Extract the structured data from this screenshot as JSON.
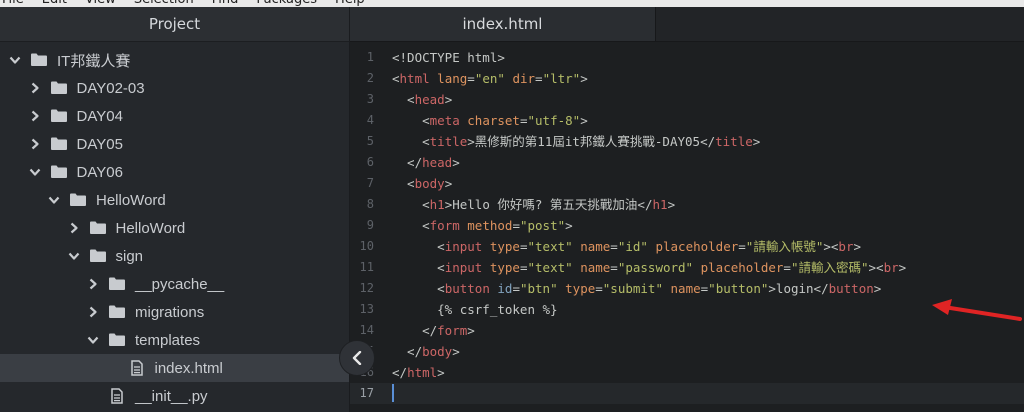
{
  "menu": [
    "File",
    "Edit",
    "View",
    "Selection",
    "Find",
    "Packages",
    "Help"
  ],
  "sidebar": {
    "title": "Project",
    "items": [
      {
        "label": "IT邦鐵人賽",
        "type": "folder",
        "expanded": true
      },
      {
        "label": "DAY02-03",
        "type": "folder",
        "expanded": false
      },
      {
        "label": "DAY04",
        "type": "folder",
        "expanded": false
      },
      {
        "label": "DAY05",
        "type": "folder",
        "expanded": false
      },
      {
        "label": "DAY06",
        "type": "folder",
        "expanded": true
      },
      {
        "label": "HelloWord",
        "type": "folder",
        "expanded": true
      },
      {
        "label": "HelloWord",
        "type": "folder",
        "expanded": false
      },
      {
        "label": "sign",
        "type": "folder",
        "expanded": true
      },
      {
        "label": "__pycache__",
        "type": "folder",
        "expanded": false
      },
      {
        "label": "migrations",
        "type": "folder",
        "expanded": false
      },
      {
        "label": "templates",
        "type": "folder",
        "expanded": true
      },
      {
        "label": "index.html",
        "type": "file",
        "selected": true
      },
      {
        "label": "__init__.py",
        "type": "file"
      }
    ]
  },
  "editor": {
    "tab": "index.html",
    "lines": [
      {
        "n": "1",
        "tokens": [
          [
            "t-text",
            "<!DOCTYPE html>"
          ]
        ]
      },
      {
        "n": "2",
        "tokens": [
          [
            "t-text",
            "<"
          ],
          [
            "t-tag",
            "html"
          ],
          [
            "t-text",
            " "
          ],
          [
            "t-attr",
            "lang"
          ],
          [
            "t-text",
            "="
          ],
          [
            "t-str",
            "\"en\""
          ],
          [
            "t-text",
            " "
          ],
          [
            "t-attr",
            "dir"
          ],
          [
            "t-text",
            "="
          ],
          [
            "t-str",
            "\"ltr\""
          ],
          [
            "t-text",
            ">"
          ]
        ]
      },
      {
        "n": "3",
        "tokens": [
          [
            "t-text",
            "  <"
          ],
          [
            "t-tag",
            "head"
          ],
          [
            "t-text",
            ">"
          ]
        ]
      },
      {
        "n": "4",
        "tokens": [
          [
            "t-text",
            "    <"
          ],
          [
            "t-tag",
            "meta"
          ],
          [
            "t-text",
            " "
          ],
          [
            "t-attr",
            "charset"
          ],
          [
            "t-text",
            "="
          ],
          [
            "t-str",
            "\"utf-8\""
          ],
          [
            "t-text",
            ">"
          ]
        ]
      },
      {
        "n": "5",
        "tokens": [
          [
            "t-text",
            "    <"
          ],
          [
            "t-tag",
            "title"
          ],
          [
            "t-text",
            ">黑修斯的第11屆it邦鐵人賽挑戰-DAY05</"
          ],
          [
            "t-tag",
            "title"
          ],
          [
            "t-text",
            ">"
          ]
        ]
      },
      {
        "n": "6",
        "tokens": [
          [
            "t-text",
            "  </"
          ],
          [
            "t-tag",
            "head"
          ],
          [
            "t-text",
            ">"
          ]
        ]
      },
      {
        "n": "7",
        "tokens": [
          [
            "t-text",
            "  <"
          ],
          [
            "t-tag",
            "body"
          ],
          [
            "t-text",
            ">"
          ]
        ]
      },
      {
        "n": "8",
        "tokens": [
          [
            "t-text",
            "    <"
          ],
          [
            "t-tag",
            "h1"
          ],
          [
            "t-text",
            ">Hello 你好嗎? 第五天挑戰加油</"
          ],
          [
            "t-tag",
            "h1"
          ],
          [
            "t-text",
            ">"
          ]
        ]
      },
      {
        "n": "9",
        "tokens": [
          [
            "t-text",
            "    <"
          ],
          [
            "t-tag",
            "form"
          ],
          [
            "t-text",
            " "
          ],
          [
            "t-attr",
            "method"
          ],
          [
            "t-text",
            "="
          ],
          [
            "t-str",
            "\"post\""
          ],
          [
            "t-text",
            ">"
          ]
        ]
      },
      {
        "n": "10",
        "tokens": [
          [
            "t-text",
            "      <"
          ],
          [
            "t-tag",
            "input"
          ],
          [
            "t-text",
            " "
          ],
          [
            "t-attr",
            "type"
          ],
          [
            "t-text",
            "="
          ],
          [
            "t-str",
            "\"text\""
          ],
          [
            "t-text",
            " "
          ],
          [
            "t-attr",
            "name"
          ],
          [
            "t-text",
            "="
          ],
          [
            "t-str",
            "\"id\""
          ],
          [
            "t-text",
            " "
          ],
          [
            "t-attr",
            "placeholder"
          ],
          [
            "t-text",
            "="
          ],
          [
            "t-str",
            "\"請輸入帳號\""
          ],
          [
            "t-text",
            "><"
          ],
          [
            "t-tag",
            "br"
          ],
          [
            "t-text",
            ">"
          ]
        ]
      },
      {
        "n": "11",
        "tokens": [
          [
            "t-text",
            "      <"
          ],
          [
            "t-tag",
            "input"
          ],
          [
            "t-text",
            " "
          ],
          [
            "t-attr",
            "type"
          ],
          [
            "t-text",
            "="
          ],
          [
            "t-str",
            "\"text\""
          ],
          [
            "t-text",
            " "
          ],
          [
            "t-attr",
            "name"
          ],
          [
            "t-text",
            "="
          ],
          [
            "t-str",
            "\"password\""
          ],
          [
            "t-text",
            " "
          ],
          [
            "t-attr",
            "placeholder"
          ],
          [
            "t-text",
            "="
          ],
          [
            "t-str",
            "\"請輸入密碼\""
          ],
          [
            "t-text",
            "><"
          ],
          [
            "t-tag",
            "br"
          ],
          [
            "t-text",
            ">"
          ]
        ]
      },
      {
        "n": "12",
        "tokens": [
          [
            "t-text",
            "      <"
          ],
          [
            "t-tag",
            "button"
          ],
          [
            "t-text",
            " "
          ],
          [
            "t-kw",
            "id"
          ],
          [
            "t-text",
            "="
          ],
          [
            "t-str",
            "\"btn\""
          ],
          [
            "t-text",
            " "
          ],
          [
            "t-attr",
            "type"
          ],
          [
            "t-text",
            "="
          ],
          [
            "t-str",
            "\"submit\""
          ],
          [
            "t-text",
            " "
          ],
          [
            "t-attr",
            "name"
          ],
          [
            "t-text",
            "="
          ],
          [
            "t-str",
            "\"button\""
          ],
          [
            "t-text",
            ">login</"
          ],
          [
            "t-tag",
            "button"
          ],
          [
            "t-text",
            ">"
          ]
        ]
      },
      {
        "n": "13",
        "tokens": [
          [
            "t-text",
            "      {% csrf_token %}"
          ]
        ]
      },
      {
        "n": "14",
        "tokens": [
          [
            "t-text",
            "    </"
          ],
          [
            "t-tag",
            "form"
          ],
          [
            "t-text",
            ">"
          ]
        ]
      },
      {
        "n": "15",
        "tokens": [
          [
            "t-text",
            "  </"
          ],
          [
            "t-tag",
            "body"
          ],
          [
            "t-text",
            ">"
          ]
        ]
      },
      {
        "n": "16",
        "tokens": [
          [
            "t-text",
            "</"
          ],
          [
            "t-tag",
            "html"
          ],
          [
            "t-text",
            ">"
          ]
        ]
      },
      {
        "n": "17",
        "tokens": []
      }
    ]
  },
  "colors": {
    "tag": "#cc6666",
    "attr": "#de935f",
    "string": "#b5bd68",
    "arrow": "#e02424"
  }
}
